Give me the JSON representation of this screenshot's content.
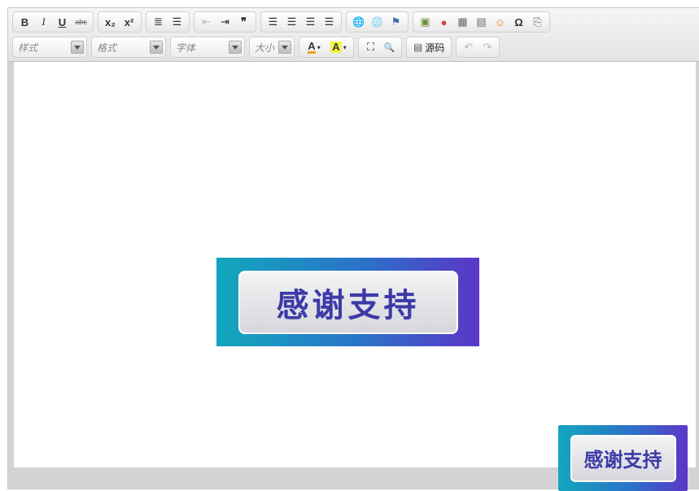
{
  "toolbar": {
    "row1": [
      {
        "group": "basic",
        "buttons": [
          {
            "name": "bold-button",
            "glyph": "B",
            "style": "font-weight:bold"
          },
          {
            "name": "italic-button",
            "glyph": "I",
            "style": "font-style:italic;font-family:serif"
          },
          {
            "name": "underline-button",
            "glyph": "U",
            "style": "text-decoration:underline;font-weight:bold"
          },
          {
            "name": "strikethrough-button",
            "glyph": "abc",
            "style": "text-decoration:line-through;font-size:9px;color:#666"
          }
        ]
      },
      {
        "group": "script",
        "buttons": [
          {
            "name": "subscript-button",
            "glyph": "x₂",
            "style": "font-weight:bold"
          },
          {
            "name": "superscript-button",
            "glyph": "x²",
            "style": "font-weight:bold"
          }
        ]
      },
      {
        "group": "lists",
        "buttons": [
          {
            "name": "numbered-list-button",
            "glyph": "≣",
            "style": ""
          },
          {
            "name": "bullet-list-button",
            "glyph": "☰",
            "style": ""
          }
        ]
      },
      {
        "group": "indent",
        "buttons": [
          {
            "name": "outdent-button",
            "glyph": "⇤",
            "style": "color:#bbb"
          },
          {
            "name": "indent-button",
            "glyph": "⇥",
            "style": ""
          },
          {
            "name": "blockquote-button",
            "glyph": "❞",
            "style": "font-weight:bold"
          }
        ]
      },
      {
        "group": "align",
        "buttons": [
          {
            "name": "align-left-button",
            "glyph": "☰",
            "style": ""
          },
          {
            "name": "align-center-button",
            "glyph": "☰",
            "style": ""
          },
          {
            "name": "align-right-button",
            "glyph": "☰",
            "style": ""
          },
          {
            "name": "align-justify-button",
            "glyph": "☰",
            "style": ""
          }
        ]
      },
      {
        "group": "links",
        "buttons": [
          {
            "name": "link-button",
            "glyph": "🌐",
            "style": "font-size:12px"
          },
          {
            "name": "unlink-button",
            "glyph": "🌐",
            "style": "font-size:12px;opacity:0.4"
          },
          {
            "name": "anchor-button",
            "glyph": "⚑",
            "style": "color:#3a6fb0"
          }
        ]
      },
      {
        "group": "insert",
        "buttons": [
          {
            "name": "image-button",
            "glyph": "▣",
            "style": "color:#6a8f3a"
          },
          {
            "name": "flash-button",
            "glyph": "●",
            "style": "color:#d9432b"
          },
          {
            "name": "table-button",
            "glyph": "▦",
            "style": "color:#666"
          },
          {
            "name": "horizontal-rule-button",
            "glyph": "▤",
            "style": "color:#666"
          },
          {
            "name": "smiley-button",
            "glyph": "☺",
            "style": "color:#e08a1e"
          },
          {
            "name": "special-char-button",
            "glyph": "Ω",
            "style": "font-weight:bold"
          },
          {
            "name": "page-break-button",
            "glyph": "⎘",
            "style": "color:#666"
          }
        ]
      }
    ],
    "combos": [
      {
        "name": "styles-combo",
        "label": "样式"
      },
      {
        "name": "format-combo",
        "label": "格式"
      },
      {
        "name": "font-combo",
        "label": "字体"
      },
      {
        "name": "size-combo",
        "label": "大小"
      }
    ],
    "text_color_glyph": "A",
    "bg_color_glyph": "A",
    "maximize_glyph": "⛶",
    "show_blocks_glyph": "🔍",
    "source_glyph": "▤",
    "source_label": "源码",
    "undo_glyph": "↶",
    "redo_glyph": "↷"
  },
  "content": {
    "badge_text": "感谢支持",
    "corner_badge_text": "感谢支持"
  },
  "colors": {
    "badge_gradient": [
      "#12a7bd",
      "#2a73c8",
      "#5b36c7"
    ],
    "badge_text": "#3d3aa8",
    "text_color_accent": "#e8a317",
    "bg_color_accent": "#f5f542"
  }
}
